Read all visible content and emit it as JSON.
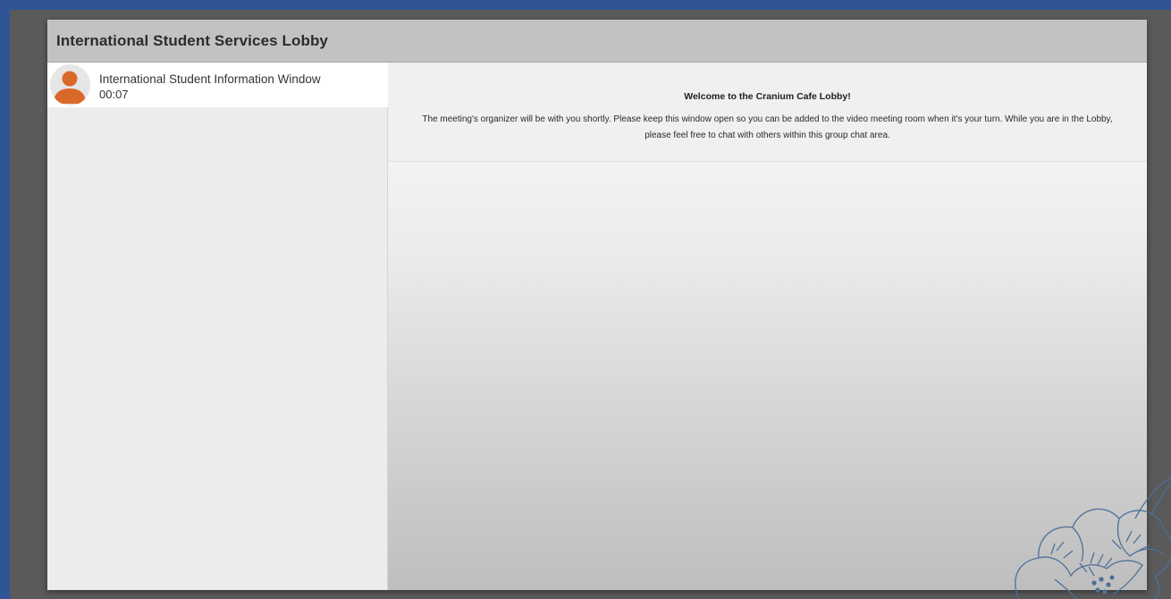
{
  "window": {
    "title": "International Student Services Lobby"
  },
  "sidebar": {
    "participants": [
      {
        "name": "International Student Information Window",
        "time": "00:07",
        "icon": "user-avatar-icon"
      }
    ]
  },
  "main": {
    "welcome_heading": "Welcome to the Cranium Cafe Lobby!",
    "welcome_message": "The meeting's organizer will be with you shortly. Please keep this window open so you can be added to the video meeting room when it's your turn. While you are in the Lobby, please feel free to chat with others within this group chat area."
  },
  "colors": {
    "background": "#2f5597",
    "frame": "#5a5a5a",
    "titlebar": "#c2c2c2",
    "avatar": "#d9692a"
  }
}
